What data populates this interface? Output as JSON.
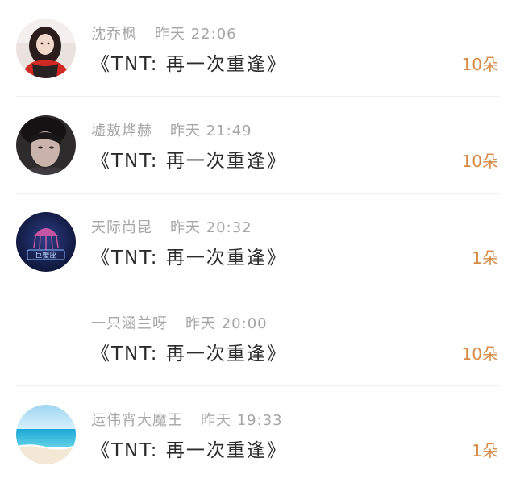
{
  "items": [
    {
      "name": "沈乔枫",
      "time": "昨天 22:06",
      "title": "《TNT: 再一次重逢》",
      "count": "10朵",
      "avatar": "portrait-red-jacket-avatar"
    },
    {
      "name": "墟敖烨赫",
      "time": "昨天 21:49",
      "title": "《TNT: 再一次重逢》",
      "count": "10朵",
      "avatar": "portrait-dark-avatar"
    },
    {
      "name": "天际尚昆",
      "time": "昨天 20:32",
      "title": "《TNT: 再一次重逢》",
      "count": "1朵",
      "avatar": "jellyfish-logo-avatar"
    },
    {
      "name": "一只涵兰呀",
      "time": "昨天 20:00",
      "title": "《TNT: 再一次重逢》",
      "count": "10朵",
      "avatar": ""
    },
    {
      "name": "运伟宵大魔王",
      "time": "昨天 19:33",
      "title": "《TNT: 再一次重逢》",
      "count": "1朵",
      "avatar": "ocean-beach-avatar"
    }
  ],
  "avatar3_badge": "巨蟹座",
  "colors": {
    "count": "#d68a44",
    "meta": "#a6a6a6",
    "title": "#2b2b2b"
  }
}
